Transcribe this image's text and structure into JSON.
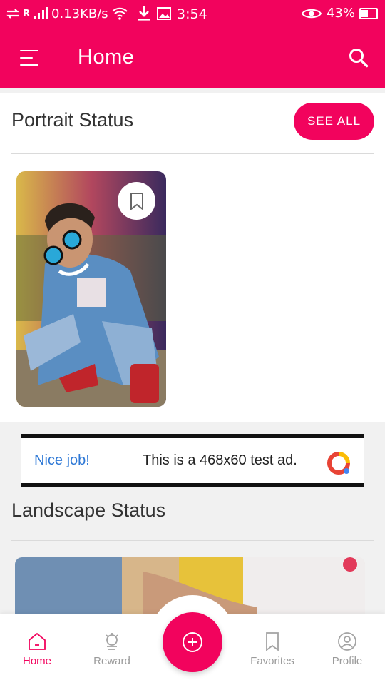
{
  "status_bar": {
    "network": "R",
    "speed": "0.13KB/s",
    "time": "3:54",
    "battery": "43%"
  },
  "app_bar": {
    "title": "Home"
  },
  "portrait": {
    "title": "Portrait Status",
    "see_all": "SEE ALL"
  },
  "ad": {
    "headline": "Nice job!",
    "text": "This is a 468x60 test ad."
  },
  "landscape": {
    "title": "Landscape Status"
  },
  "bottom_nav": {
    "items": [
      {
        "label": "Home",
        "icon": "home-icon",
        "active": true
      },
      {
        "label": "Reward",
        "icon": "reward-icon",
        "active": false
      },
      {
        "label": "Favorites",
        "icon": "bookmark-icon",
        "active": false
      },
      {
        "label": "Profile",
        "icon": "profile-icon",
        "active": false
      }
    ],
    "fab_icon": "add-circle-icon"
  },
  "colors": {
    "accent": "#f2035d",
    "inactive": "#9b9b9b",
    "ad_link": "#2f79d6"
  }
}
